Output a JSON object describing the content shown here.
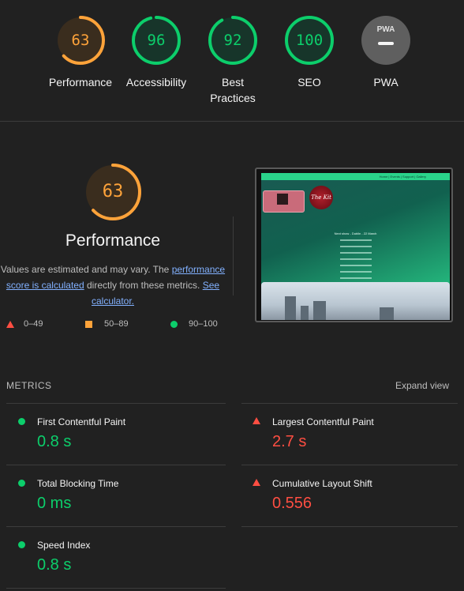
{
  "colors": {
    "pass": "#0cce6b",
    "average": "#ffa33a",
    "fail": "#ff4e42",
    "pwa": "#5f5f5f"
  },
  "gauges": [
    {
      "score": "63",
      "label": "Performance",
      "status": "average",
      "fraction": 0.63
    },
    {
      "score": "96",
      "label": "Accessibility",
      "status": "pass",
      "fraction": 0.96
    },
    {
      "score": "92",
      "label": "Best Practices",
      "status": "pass",
      "fraction": 0.92
    },
    {
      "score": "100",
      "label": "SEO",
      "status": "pass",
      "fraction": 1.0
    },
    {
      "score": "PWA",
      "label": "PWA",
      "status": "pwa",
      "icon": "pwa-badge-icon"
    }
  ],
  "performance": {
    "score": "63",
    "fraction": 0.63,
    "title": "Performance",
    "desc_before": "Values are estimated and may vary. The",
    "link1": "performance score is calculated",
    "desc_middle": "directly from these metrics.",
    "link2": "See calculator."
  },
  "legend": [
    {
      "icon": "triangle-icon",
      "range": "0–49"
    },
    {
      "icon": "square-icon",
      "range": "50–89"
    },
    {
      "icon": "circle-icon",
      "range": "90–100"
    }
  ],
  "screenshot": {
    "nav": "Home  |  Events  |  Support  |  Gallery",
    "logo": "The Kit",
    "heading": "Next show - Dublin - 22 March"
  },
  "metrics": {
    "header": "METRICS",
    "expand": "Expand view",
    "items": [
      {
        "label": "First Contentful Paint",
        "value": "0.8 s",
        "status": "pass"
      },
      {
        "label": "Largest Contentful Paint",
        "value": "2.7 s",
        "status": "fail"
      },
      {
        "label": "Total Blocking Time",
        "value": "0 ms",
        "status": "pass"
      },
      {
        "label": "Cumulative Layout Shift",
        "value": "0.556",
        "status": "fail"
      },
      {
        "label": "Speed Index",
        "value": "0.8 s",
        "status": "pass"
      }
    ]
  }
}
